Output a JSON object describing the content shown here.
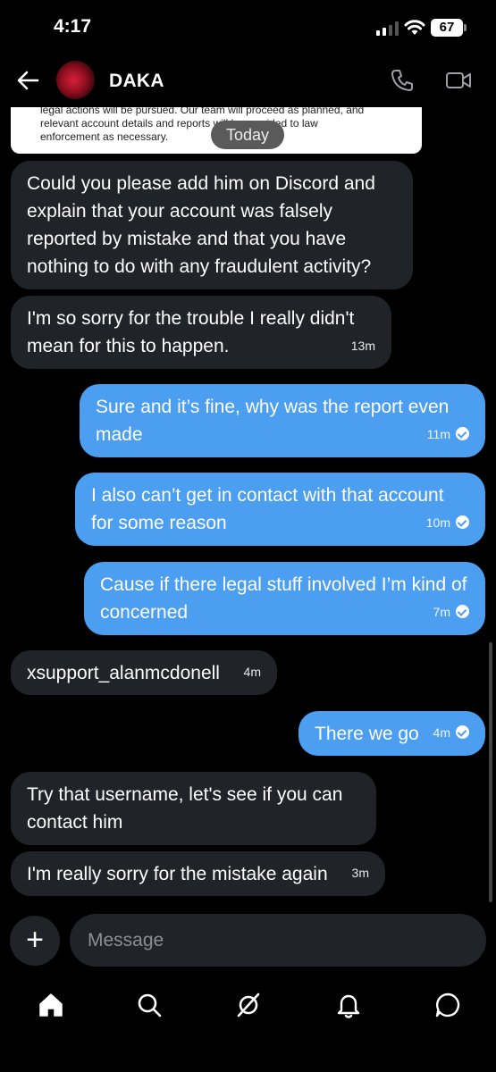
{
  "status_bar": {
    "time": "4:17",
    "battery": "67"
  },
  "header": {
    "contact_name": "DAKA"
  },
  "attachment": {
    "lines": [
      "legal actions will be pursued. Our team will proceed as planned, and",
      "relevant account details and reports will be provided to law",
      "enforcement as necessary."
    ]
  },
  "date_divider": "Today",
  "messages": [
    {
      "direction": "in",
      "text": "Could you please add him on Discord and explain that your account was falsely reported by mistake and that you have nothing to do with any fraudulent activity?",
      "time": ""
    },
    {
      "direction": "in",
      "text": "I'm so sorry for the trouble I really didn't mean for this to happen.",
      "time": "13m"
    },
    {
      "direction": "out",
      "text": "Sure and it’s fine, why was the report even made",
      "time": "11m"
    },
    {
      "direction": "out",
      "text": "I also can’t get in contact with that account for some reason",
      "time": "10m"
    },
    {
      "direction": "out",
      "text": "Cause if there legal stuff involved I’m kind of concerned",
      "time": "7m"
    },
    {
      "direction": "in",
      "text": "xsupport_alanmcdonell",
      "time": "4m"
    },
    {
      "direction": "out",
      "text": "There we go",
      "time": "4m"
    },
    {
      "direction": "in",
      "text": "Try that username, let's see if you can contact him",
      "time": ""
    },
    {
      "direction": "in",
      "text": "I'm really sorry for the mistake again",
      "time": "3m"
    }
  ],
  "compose": {
    "placeholder": "Message",
    "add_label": "+"
  },
  "tabbar": {
    "items": [
      "home-icon",
      "search-icon",
      "grok-icon",
      "notifications-icon",
      "messages-icon"
    ]
  },
  "colors": {
    "background": "#000000",
    "incoming_bubble": "#202327",
    "outgoing_bubble": "#4c9ef0"
  }
}
